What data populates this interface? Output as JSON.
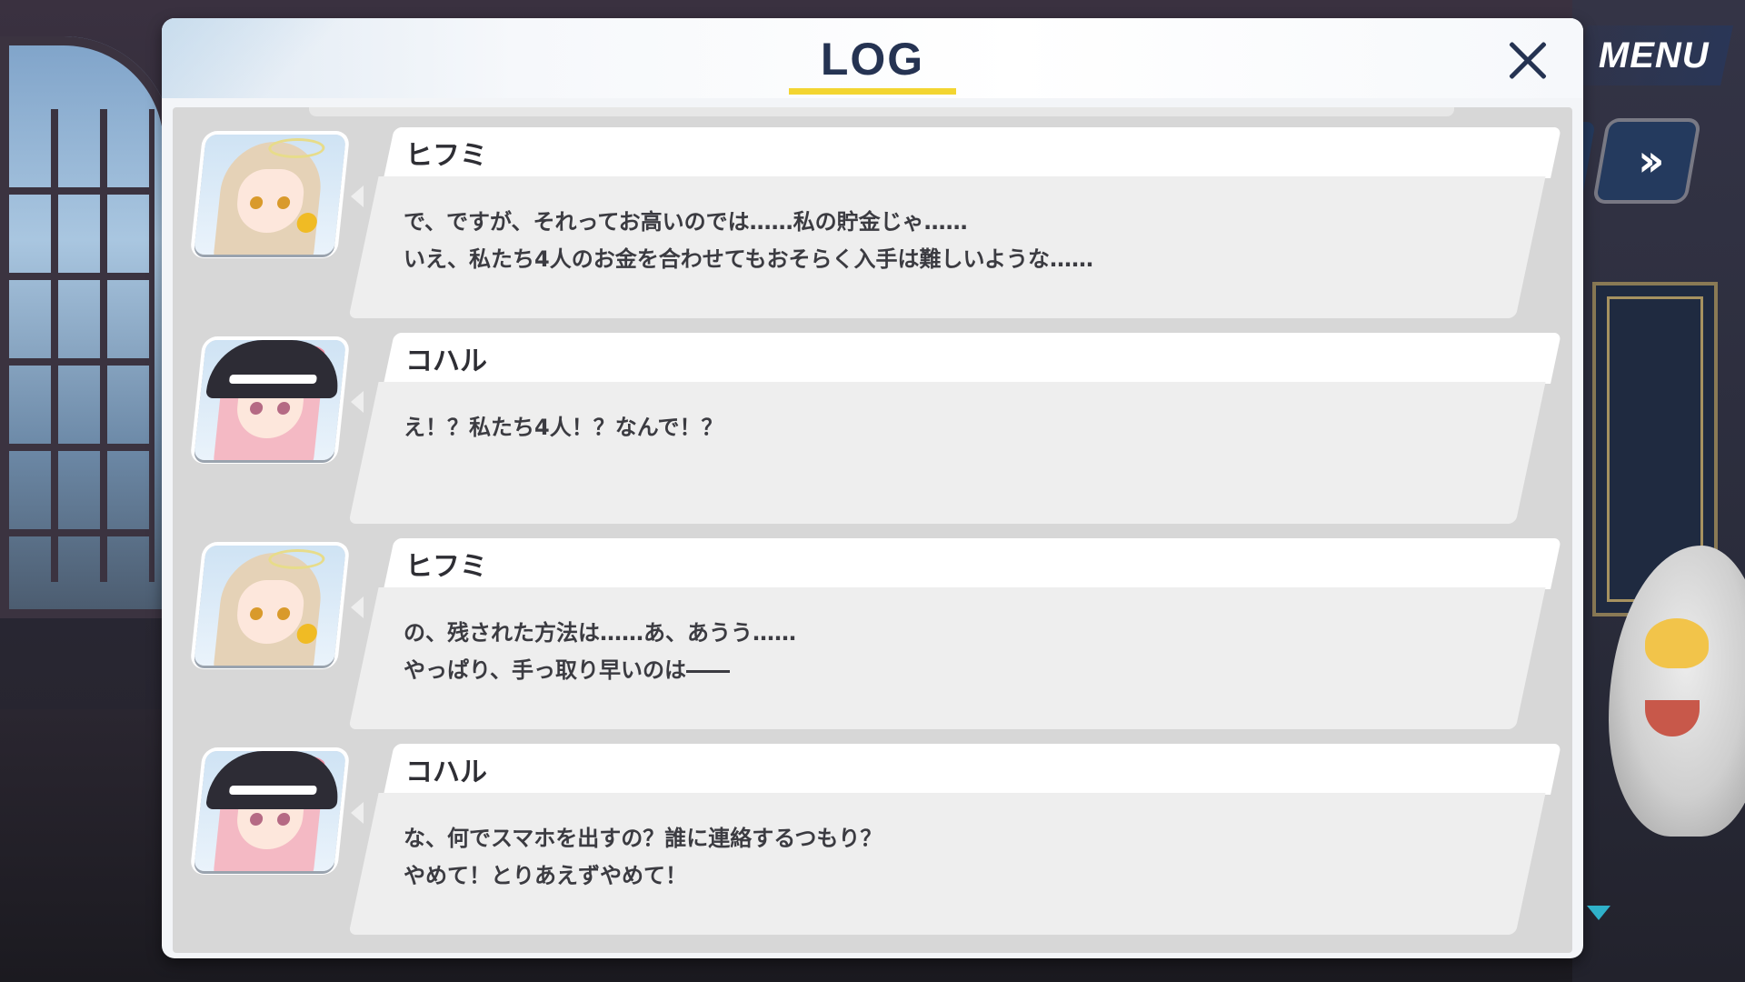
{
  "hud": {
    "menu_label": "MENU",
    "fast_forward_symbol": "»"
  },
  "log": {
    "title": "LOG",
    "close_symbol": "close",
    "entries": [
      {
        "speaker": "ヒフミ",
        "avatar": "hifumi",
        "lines": [
          "で、ですが、それってお高いのでは……私の貯金じゃ……",
          "いえ、私たち4人のお金を合わせてもおそらく入手は難しいような……"
        ]
      },
      {
        "speaker": "コハル",
        "avatar": "koharu",
        "lines": [
          "え！？私たち4人！？なんで！？",
          ""
        ]
      },
      {
        "speaker": "ヒフミ",
        "avatar": "hifumi",
        "lines": [
          "の、残された方法は……あ、あうう……",
          "やっぱり、手っ取り早いのは――"
        ]
      },
      {
        "speaker": "コハル",
        "avatar": "koharu",
        "lines": [
          "な、何でスマホを出すの？誰に連絡するつもり？",
          "やめて！とりあえずやめて！"
        ]
      }
    ]
  },
  "colors": {
    "title_underline": "#f3d531",
    "title_text": "#253352",
    "scroll_indicator": "#2fb1c9",
    "hud_button": "#243a5e"
  }
}
